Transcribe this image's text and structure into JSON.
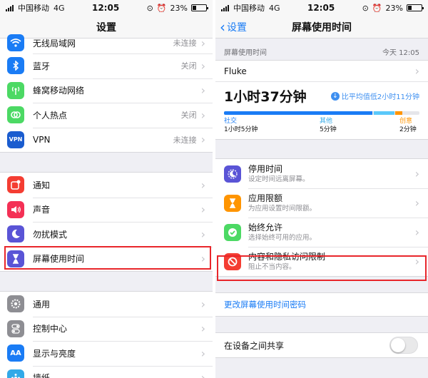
{
  "status": {
    "carrier": "中国移动",
    "network": "4G",
    "time": "12:05",
    "battery": "23%"
  },
  "left": {
    "title": "设置",
    "group1": [
      {
        "name": "wifi",
        "label": "无线局域网",
        "value": "未连接",
        "color": "#1a7cf5",
        "icon": "wifi-icon"
      },
      {
        "name": "bluetooth",
        "label": "蓝牙",
        "value": "关闭",
        "color": "#1a7cf5",
        "icon": "bluetooth-icon"
      },
      {
        "name": "cellular",
        "label": "蜂窝移动网络",
        "value": "",
        "color": "#4cd964",
        "icon": "cellular-icon"
      },
      {
        "name": "hotspot",
        "label": "个人热点",
        "value": "关闭",
        "color": "#4cd964",
        "icon": "hotspot-icon"
      },
      {
        "name": "vpn",
        "label": "VPN",
        "value": "未连接",
        "color": "#1a5ccf",
        "icon": "vpn-icon",
        "glyph": "VPN"
      }
    ],
    "group2": [
      {
        "name": "notifications",
        "label": "通知",
        "color": "#f43d32",
        "icon": "notifications-icon"
      },
      {
        "name": "sounds",
        "label": "声音",
        "color": "#f43055",
        "icon": "sound-icon"
      },
      {
        "name": "dnd",
        "label": "勿扰模式",
        "color": "#5a54d6",
        "icon": "moon-icon"
      },
      {
        "name": "screen-time",
        "label": "屏幕使用时间",
        "color": "#5a54d6",
        "icon": "hourglass-icon"
      }
    ],
    "group3": [
      {
        "name": "general",
        "label": "通用",
        "color": "#8e8e93",
        "icon": "gear-icon"
      },
      {
        "name": "control-center",
        "label": "控制中心",
        "color": "#8e8e93",
        "icon": "toggles-icon"
      },
      {
        "name": "display",
        "label": "显示与亮度",
        "color": "#1a7cf5",
        "icon": "display-icon",
        "glyph": "AA"
      },
      {
        "name": "wallpaper",
        "label": "墙纸",
        "color": "#32a9e8",
        "icon": "wallpaper-icon"
      }
    ]
  },
  "right": {
    "back_label": "设置",
    "title": "屏幕使用时间",
    "caption": "屏幕使用时间",
    "caption_time": "今天 12:05",
    "device": "Fluke",
    "total": "1小时37分钟",
    "compare": "比平均值低2小时11分钟",
    "usage_bar": [
      {
        "name": "social",
        "fraction": 0.76,
        "color": "#1a7cf5"
      },
      {
        "name": "other",
        "fraction": 0.105,
        "color": "#5ac8fa"
      },
      {
        "name": "creativity",
        "fraction": 0.035,
        "color": "#ff9500"
      }
    ],
    "legend": [
      {
        "name": "social",
        "category": "社交",
        "amount": "1小时5分钟",
        "color": "#1a7cf5"
      },
      {
        "name": "other",
        "category": "其他",
        "amount": "5分钟",
        "color": "#32a9e8"
      },
      {
        "name": "creativity",
        "category": "创意",
        "amount": "2分钟",
        "color": "#ff9500"
      }
    ],
    "features": [
      {
        "name": "downtime",
        "title": "停用时间",
        "subtitle": "设定时间远离屏幕。",
        "color": "#5a54d6",
        "icon": "downtime-icon"
      },
      {
        "name": "app-limits",
        "title": "应用限额",
        "subtitle": "为应用设置时间限额。",
        "color": "#ff9500",
        "icon": "hourglass-icon"
      },
      {
        "name": "always-allowed",
        "title": "始终允许",
        "subtitle": "选择始终可用的应用。",
        "color": "#4cd964",
        "icon": "check-badge-icon"
      },
      {
        "name": "content-privacy",
        "title": "内容和隐私访问限制",
        "subtitle": "阻止不当内容。",
        "color": "#f43d32",
        "icon": "restriction-icon"
      }
    ],
    "change_passcode": "更改屏幕使用时间密码",
    "share_label": "在设备之间共享",
    "share_on": false
  }
}
